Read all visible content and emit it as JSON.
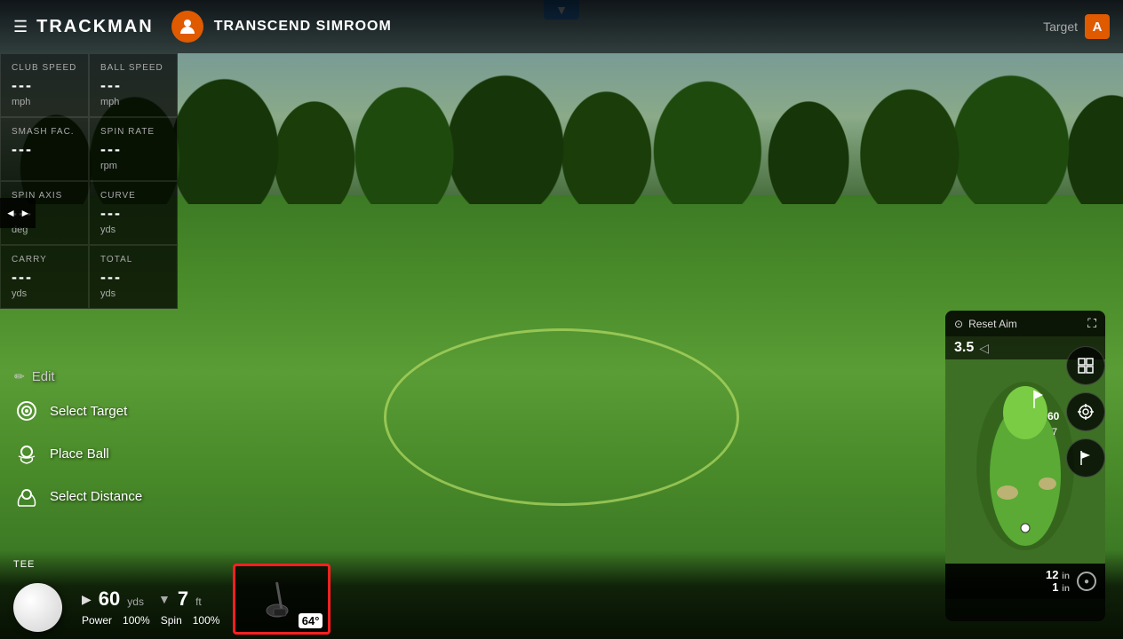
{
  "header": {
    "menu_icon": "☰",
    "logo": "TRACKMAN",
    "player_name": "TRANSCEND SIMROOM",
    "target_label": "Target",
    "target_badge": "A"
  },
  "stats": {
    "club_speed": {
      "label": "CLUB SPEED",
      "value": "---",
      "unit": "mph"
    },
    "ball_speed": {
      "label": "BALL SPEED",
      "value": "---",
      "unit": "mph"
    },
    "smash_fac": {
      "label": "SMASH FAC.",
      "value": "---",
      "unit": ""
    },
    "spin_rate": {
      "label": "SPIN RATE",
      "value": "---",
      "unit": "rpm"
    },
    "spin_axis": {
      "label": "SPIN AXIS",
      "value": "---",
      "unit": "deg"
    },
    "curve": {
      "label": "CURVE",
      "value": "---",
      "unit": "yds"
    },
    "carry": {
      "label": "CARRY",
      "value": "---",
      "unit": "yds"
    },
    "total": {
      "label": "TOTAL",
      "value": "---",
      "unit": "yds"
    }
  },
  "left_menu": {
    "edit_label": "Edit",
    "select_target_label": "Select Target",
    "place_ball_label": "Place Ball",
    "select_distance_label": "Select Distance"
  },
  "bottom_bar": {
    "tee_label": "TEE",
    "distance_value": "60",
    "distance_unit": "yds",
    "height_value": "7",
    "height_unit": "ft",
    "power_label": "Power",
    "power_value": "100",
    "spin_label": "Spin",
    "spin_value": "100",
    "club_degree": "64°"
  },
  "mini_map": {
    "reset_aim_label": "Reset Aim",
    "distance_value": "3.5",
    "map_distance": "60",
    "map_distance2": "7",
    "dist_12_label": "12",
    "dist_in_label": "in",
    "dist_1_label": "1",
    "dist_1_in_label": "in"
  },
  "top_dropdown": {
    "icon": "▼"
  }
}
